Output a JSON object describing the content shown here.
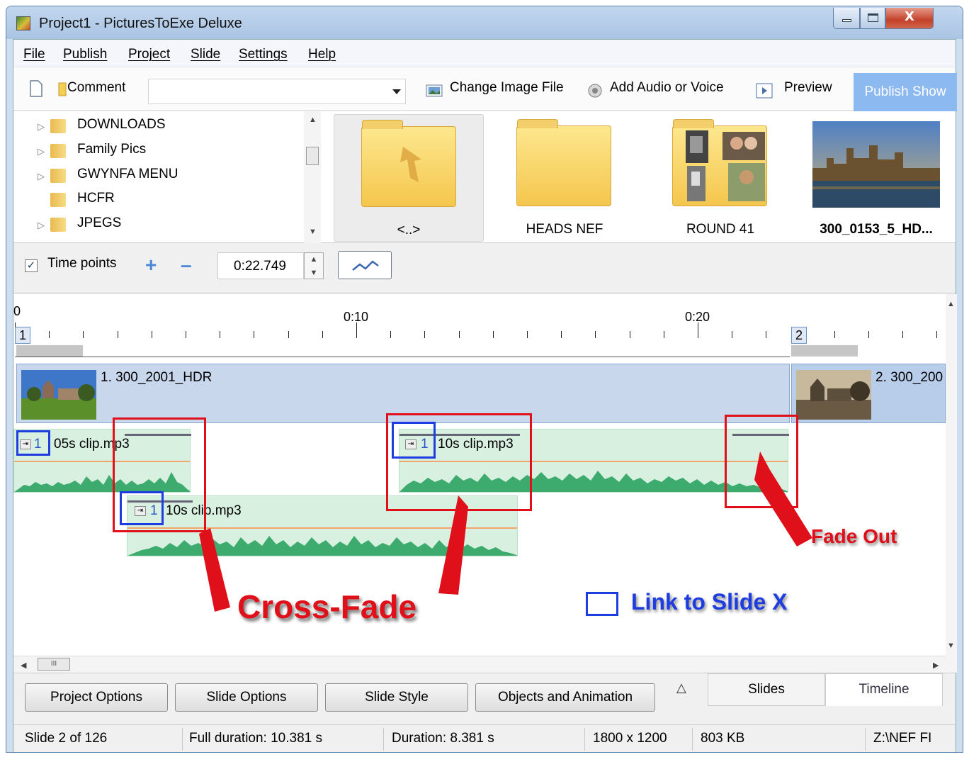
{
  "window": {
    "title": "Project1 - PicturesToExe Deluxe",
    "close_glyph": "X"
  },
  "menu": [
    "File",
    "Publish",
    "Project",
    "Slide",
    "Settings",
    "Help"
  ],
  "toolbar": {
    "comment_label": "Comment",
    "comment_value": "",
    "change_image": "Change Image File",
    "add_audio": "Add Audio or Voice",
    "preview": "Preview",
    "publish": "Publish Show"
  },
  "tree": {
    "items": [
      {
        "label": "DOWNLOADS",
        "expandable": true
      },
      {
        "label": "Family Pics",
        "expandable": true
      },
      {
        "label": "GWYNFA MENU",
        "expandable": true
      },
      {
        "label": "HCFR",
        "expandable": false
      },
      {
        "label": "JPEGS",
        "expandable": true
      }
    ]
  },
  "thumbnails": [
    {
      "label": "<..>"
    },
    {
      "label": "HEADS NEF"
    },
    {
      "label": "ROUND 41"
    },
    {
      "label": "300_0153_5_HD..."
    }
  ],
  "timepoints": {
    "label": "Time points",
    "checked": true,
    "time_value": "0:22.749"
  },
  "ruler": {
    "labels": [
      "0",
      "0:10",
      "0:20"
    ],
    "slide_markers": [
      "1",
      "2"
    ]
  },
  "slides": [
    {
      "label": "1. 300_2001_HDR"
    },
    {
      "label": "2. 300_200"
    }
  ],
  "audio": [
    {
      "num": "1",
      "label": "05s clip.mp3"
    },
    {
      "num": "1",
      "label": "10s clip.mp3"
    },
    {
      "num": "1",
      "label": "10s clip.mp3"
    }
  ],
  "annotations": {
    "cross_fade": "Cross-Fade",
    "fade_out": "Fade Out",
    "link_to_slide": "Link to Slide X"
  },
  "scroll": {
    "thumb_glyph": "III"
  },
  "buttons": {
    "project_options": "Project Options",
    "slide_options": "Slide Options",
    "slide_style": "Slide Style",
    "objects_animation": "Objects and Animation",
    "tab_slides": "Slides",
    "tab_timeline": "Timeline"
  },
  "status": {
    "slide": "Slide 2 of 126",
    "full_duration": "Full duration: 10.381 s",
    "duration": "Duration: 8.381 s",
    "size": "1800 x 1200",
    "file_size": "803 KB",
    "path": "Z:\\NEF FI"
  },
  "colors": {
    "accent": "#8cb9f0",
    "annotation_red": "#e0101a",
    "annotation_blue": "#1d3de0",
    "audio_green": "#3daa6e"
  }
}
